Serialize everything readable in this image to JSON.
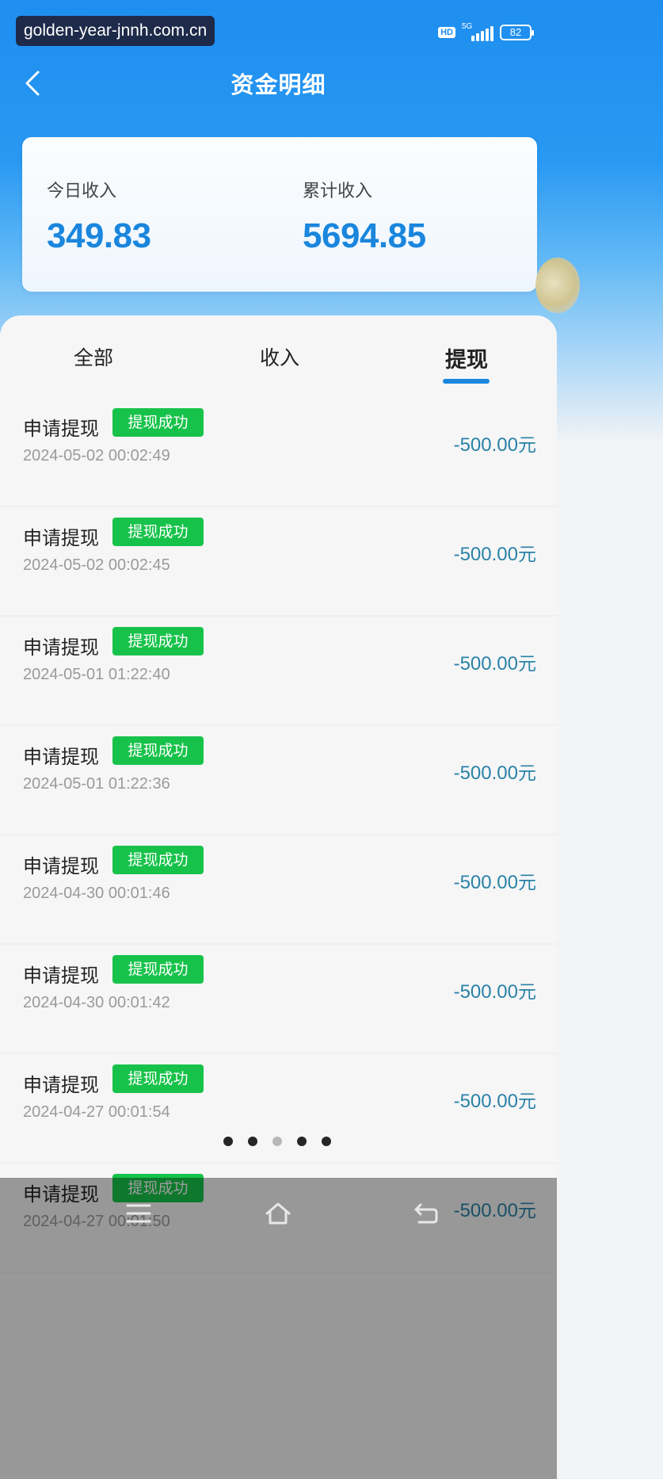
{
  "status_bar": {
    "url": "golden-year-jnnh.com.cn",
    "hd": "HD",
    "network": "5G",
    "battery": "82"
  },
  "header": {
    "title": "资金明细",
    "back_icon": "chevron-left-icon"
  },
  "summary": {
    "today_label": "今日收入",
    "today_value": "349.83",
    "total_label": "累计收入",
    "total_value": "5694.85"
  },
  "tabs": [
    {
      "label": "全部",
      "active": false
    },
    {
      "label": "收入",
      "active": false
    },
    {
      "label": "提现",
      "active": true
    }
  ],
  "transactions": [
    {
      "title": "申请提现",
      "status": "提现成功",
      "time": "2024-05-02 00:02:49",
      "amount": "-500.00",
      "unit": "元"
    },
    {
      "title": "申请提现",
      "status": "提现成功",
      "time": "2024-05-02 00:02:45",
      "amount": "-500.00",
      "unit": "元"
    },
    {
      "title": "申请提现",
      "status": "提现成功",
      "time": "2024-05-01 01:22:40",
      "amount": "-500.00",
      "unit": "元"
    },
    {
      "title": "申请提现",
      "status": "提现成功",
      "time": "2024-05-01 01:22:36",
      "amount": "-500.00",
      "unit": "元"
    },
    {
      "title": "申请提现",
      "status": "提现成功",
      "time": "2024-04-30 00:01:46",
      "amount": "-500.00",
      "unit": "元"
    },
    {
      "title": "申请提现",
      "status": "提现成功",
      "time": "2024-04-30 00:01:42",
      "amount": "-500.00",
      "unit": "元"
    },
    {
      "title": "申请提现",
      "status": "提现成功",
      "time": "2024-04-27 00:01:54",
      "amount": "-500.00",
      "unit": "元"
    },
    {
      "title": "申请提现",
      "status": "提现成功",
      "time": "2024-04-27 00:01:50",
      "amount": "-500.00",
      "unit": "元"
    }
  ],
  "pager": {
    "count": 5,
    "active_index": 2
  },
  "system_nav": [
    "menu-icon",
    "home-icon",
    "back-icon"
  ],
  "colors": {
    "header_blue": "#1e8ef0",
    "value_blue": "#1a86dd",
    "success_green": "#17c24a",
    "amount_teal": "#2a82a8"
  }
}
